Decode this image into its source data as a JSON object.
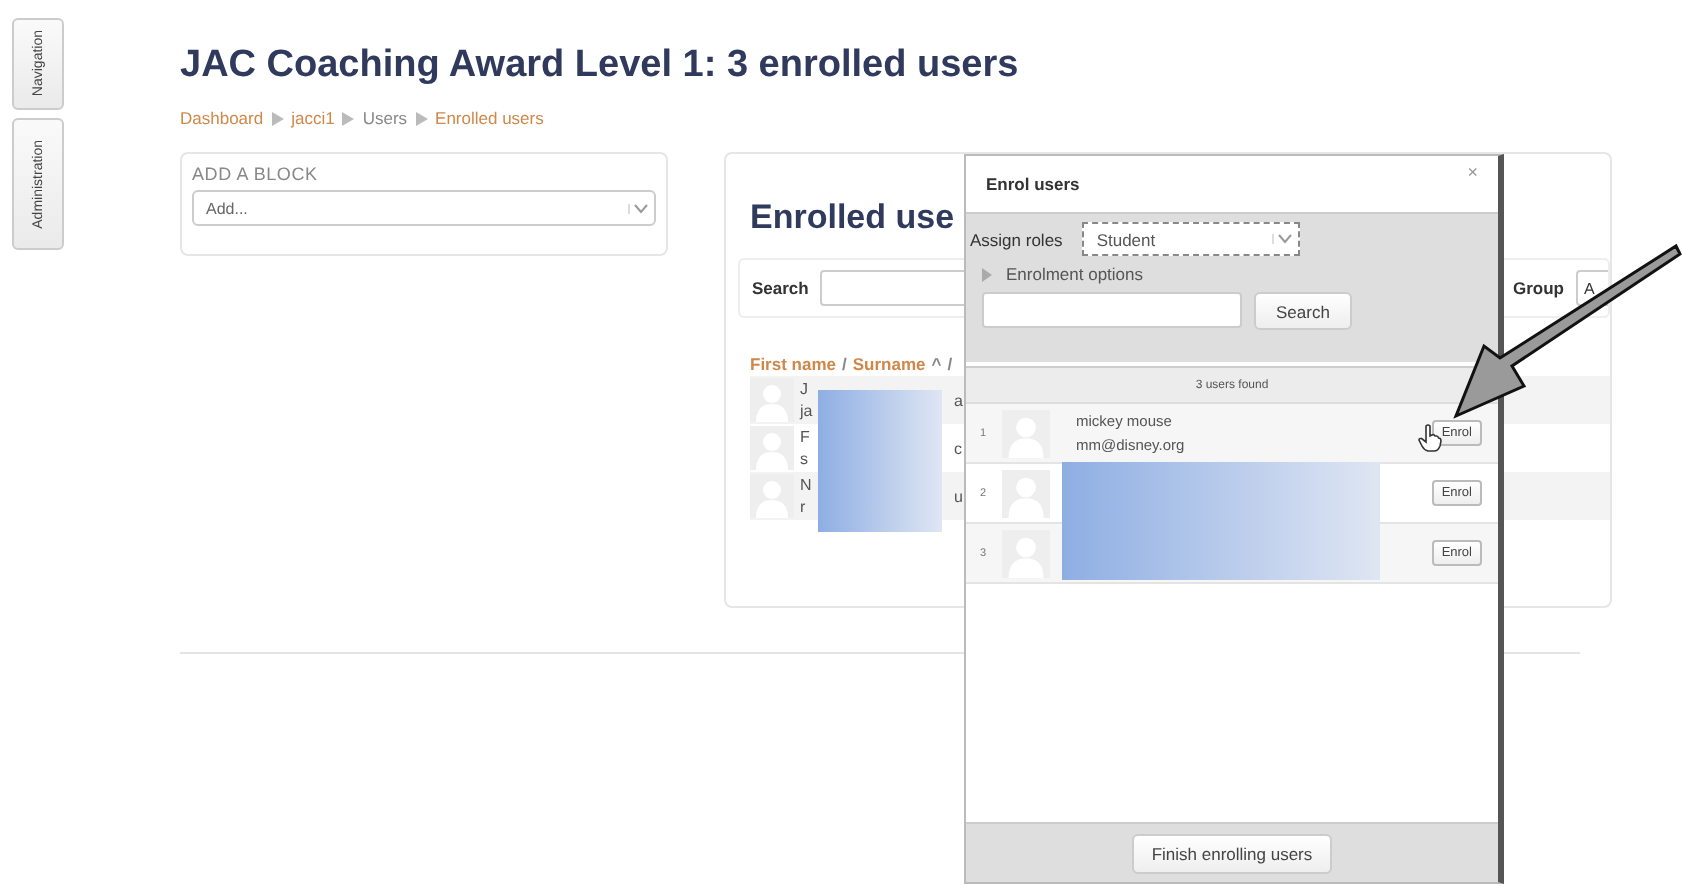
{
  "side_tabs": [
    {
      "label": "Navigation"
    },
    {
      "label": "Administration"
    }
  ],
  "page_title": "JAC Coaching Award Level 1: 3 enrolled users",
  "breadcrumb": [
    "Dashboard",
    "jacci1",
    "Users",
    "Enrolled users"
  ],
  "add_block": {
    "title": "ADD A BLOCK",
    "select": "Add..."
  },
  "enrolled": {
    "heading": "Enrolled use",
    "search_label": "Search",
    "group_label": "Group",
    "group_value": "A",
    "header_parts": [
      {
        "text": "First name",
        "kind": "link"
      },
      {
        "text": "/",
        "kind": "sep"
      },
      {
        "text": "Surname",
        "kind": "link"
      },
      {
        "text": "^",
        "kind": "caret"
      },
      {
        "text": "/",
        "kind": "sep"
      }
    ],
    "rows": [
      {
        "name": "J",
        "email": "ja",
        "tail": "a"
      },
      {
        "name": "F",
        "email": "s",
        "tail": "c"
      },
      {
        "name": "N",
        "email": "r",
        "tail": "u"
      }
    ]
  },
  "modal": {
    "title": "Enrol users",
    "close": "×",
    "assign_label": "Assign roles",
    "role": "Student",
    "options": "Enrolment options",
    "search_button": "Search",
    "found": "3 users found",
    "users": [
      {
        "index": "1",
        "name": "mickey mouse",
        "email": "mm@disney.org",
        "button": "Enrol"
      },
      {
        "index": "2",
        "button": "Enrol"
      },
      {
        "index": "3",
        "button": "Enrol"
      }
    ],
    "finish": "Finish enrolling users"
  }
}
